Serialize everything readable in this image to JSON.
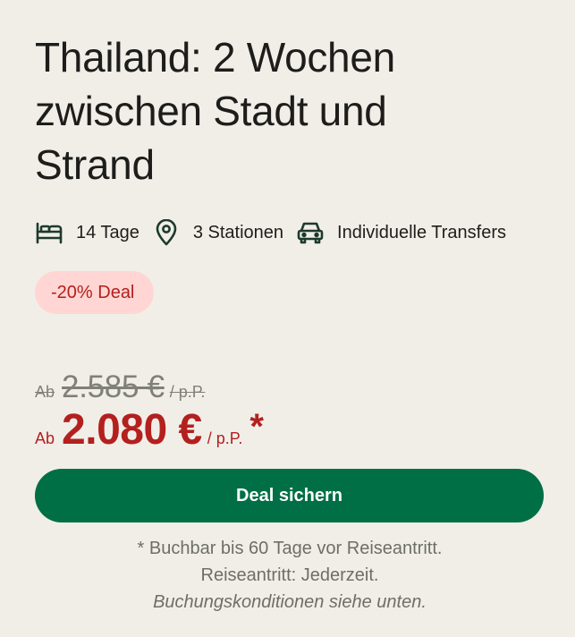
{
  "offer": {
    "title_lines": [
      "Thailand: 2 Wochen",
      "zwischen Stadt und",
      "Strand"
    ],
    "features": [
      {
        "icon": "bed-icon",
        "label": "14 Tage"
      },
      {
        "icon": "location-pin-icon",
        "label": "3 Stationen"
      },
      {
        "icon": "car-icon",
        "label": "Individuelle Transfers"
      }
    ],
    "badge": "-20% Deal",
    "old_price": {
      "prefix": "Ab",
      "amount": "2.585 €",
      "suffix": "/ p.P."
    },
    "new_price": {
      "prefix": "Ab",
      "amount": "2.080 €",
      "suffix": "/ p.P.",
      "asterisk": "*"
    },
    "cta_label": "Deal sichern",
    "notes": {
      "line1": "* Buchbar bis 60 Tage vor Reiseantritt.",
      "line2": "Reiseantritt: Jederzeit.",
      "line3": "Buchungskonditionen siehe unten."
    }
  },
  "colors": {
    "background": "#f1eee8",
    "text": "#1d1d1b",
    "accent_red": "#b3201e",
    "badge_bg": "#ffd6d3",
    "cta_green": "#006f45",
    "muted": "#80807b"
  }
}
